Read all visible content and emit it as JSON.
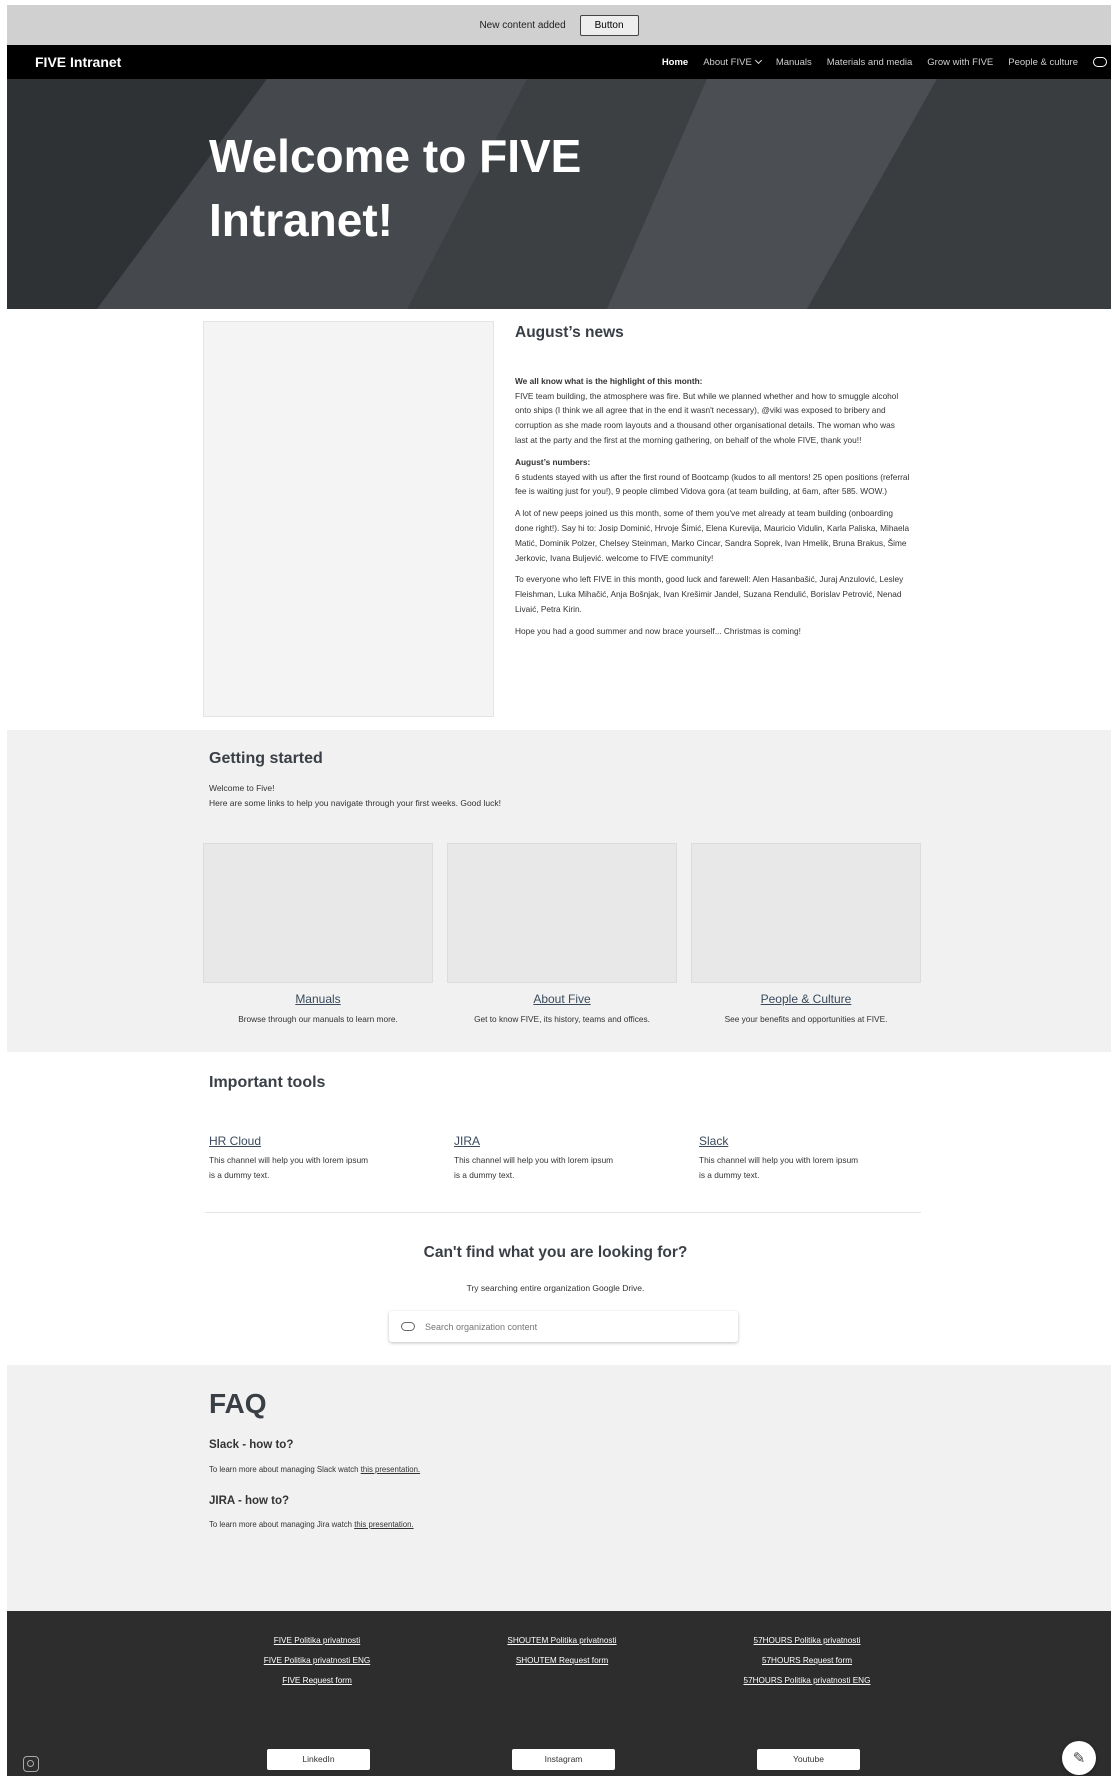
{
  "notice": {
    "text": "New content added",
    "button": "Button"
  },
  "nav": {
    "brand": "FIVE Intranet",
    "items": [
      "Home",
      "About FIVE",
      "Manuals",
      "Materials and media",
      "Grow with FIVE",
      "People & culture"
    ]
  },
  "hero": {
    "title_line1": "Welcome to FIVE",
    "title_line2": "Intranet!"
  },
  "news": {
    "title": "August’s news",
    "p1_bold": "We all know what is the highlight of this month:",
    "p1": "FIVE team building, the atmosphere was fire. But while we planned whether and how to smuggle alcohol onto ships (I think we all agree that in the end it wasn't necessary), @viki was exposed to bribery and corruption as she made room layouts and a thousand other organisational details. The woman who was last at the party and the first at the morning gathering, on behalf of the whole FIVE, thank you!!",
    "p2_bold": "August’s numbers:",
    "p2": "6 students stayed with us after the first round of Bootcamp (kudos to all mentors! 25 open positions (referral fee is waiting just for you!), 9 people climbed Vidova gora (at team building, at 6am, after 585. WOW.)",
    "p3": "A lot of new peeps joined us this month, some of them you've met already at team building (onboarding done right!). Say hi to: Josip Dominić, Hrvoje Šimić, Elena Kurevija, Mauricio Vidulin, Karla Paliska, Mihaela Matić, Dominik Polzer, Chelsey Steinman, Marko Cincar, Sandra Soprek, Ivan Hmelik, Bruna Brakus, Šime Jerkovic, Ivana Buljević. welcome to FIVE community!",
    "p4": "To everyone who left FIVE in this month, good luck and farewell: Alen Hasanbašić, Juraj Anzulović, Lesley Fleishman, Luka Mihačić, Anja Bošnjak, Ivan Krešimir Jandel, Suzana Rendulić, Borislav Petrović, Nenad Livaić, Petra Kirin.",
    "p5": "Hope you had a good summer and now brace yourself... Christmas is coming!"
  },
  "getting_started": {
    "title": "Getting started",
    "line1": "Welcome to Five!",
    "line2": "Here are some links to help you navigate through your first weeks. Good luck!",
    "cards": [
      {
        "title": "Manuals",
        "desc": "Browse through our manuals to learn more."
      },
      {
        "title": "About Five",
        "desc": "Get to know FIVE, its history, teams and offices."
      },
      {
        "title": "People & Culture",
        "desc": "See your benefits and opportunities at FIVE."
      }
    ]
  },
  "tools": {
    "title": "Important tools",
    "items": [
      {
        "name": "HR Cloud",
        "desc1": "This channel will help you with lorem ipsum",
        "desc2": "is a dummy text."
      },
      {
        "name": "JIRA",
        "desc1": "This channel will help you with lorem ipsum",
        "desc2": "is a dummy text."
      },
      {
        "name": "Slack",
        "desc1": "This channel will help you with lorem ipsum",
        "desc2": "is a dummy text."
      }
    ]
  },
  "search": {
    "title": "Can't find what you are looking for?",
    "subtitle": "Try searching entire organization Google Drive.",
    "placeholder": "Search organization content"
  },
  "faq": {
    "title": "FAQ",
    "q1": "Slack - how to?",
    "a1": "To learn more about managing Slack watch ",
    "q2": "JIRA - how to?",
    "a2": "To learn more about managing Jira watch ",
    "link": "this presentation."
  },
  "footer": {
    "col1": [
      "FIVE Politika privatnosti",
      "FIVE Politika privatnosti ENG",
      "FIVE Request form"
    ],
    "col2": [
      "SHOUTEM Politika privatnosti",
      "SHOUTEM Request form"
    ],
    "col3": [
      "57HOURS Politika privatnosti",
      "57HOURS Request form",
      "57HOURS Politika privatnosti ENG"
    ],
    "social": [
      "LinkedIn",
      "Instagram",
      "Youtube"
    ]
  },
  "icons": {
    "nav_cloud": "cloud-icon",
    "search_cloud": "cloud-icon",
    "camera": "camera-icon",
    "edit": "pencil-icon"
  }
}
